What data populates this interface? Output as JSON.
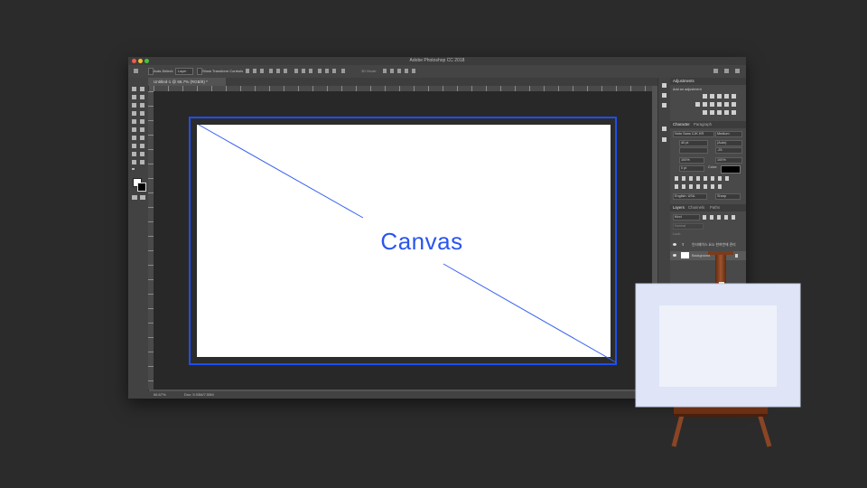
{
  "window": {
    "title": "Adobe Photoshop CC 2018"
  },
  "options_bar": {
    "auto_select_label": "Auto-Select:",
    "auto_select_value": "Layer",
    "transform_controls_label": "Show Transform Controls",
    "mode_3d": "3D Mode:"
  },
  "document_tab": {
    "label": "Untitled-1 @ 66.7% (RGB/8) *"
  },
  "status_bar": {
    "zoom": "66.67%",
    "doc_info": "Doc: 5.93M/7.55M"
  },
  "canvas": {
    "label": "Canvas",
    "accent_color": "#2a55f0"
  },
  "panels": {
    "adjustments": {
      "title": "Adjustments",
      "subtitle": "Add an adjustment"
    },
    "character": {
      "tabs": [
        "Character",
        "Paragraph"
      ],
      "font_family": "Noto Sans CJK KR",
      "font_style": "Medium",
      "font_size": "40 pt",
      "leading": "(Auto)",
      "tracking": "-25",
      "vertical_scale": "100%",
      "horizontal_scale": "100%",
      "baseline": "0 pt",
      "color_label": "Color:",
      "language": "English: USA",
      "antialias": "Sharp"
    },
    "layers": {
      "tabs": [
        "Layers",
        "Channels",
        "Paths"
      ],
      "filter": "Kind",
      "blend_mode": "Normal",
      "lock_label": "Lock:",
      "items": [
        {
          "name": "인터페이스 요소 한꺼번에 관리"
        },
        {
          "name": "Background"
        }
      ]
    }
  }
}
